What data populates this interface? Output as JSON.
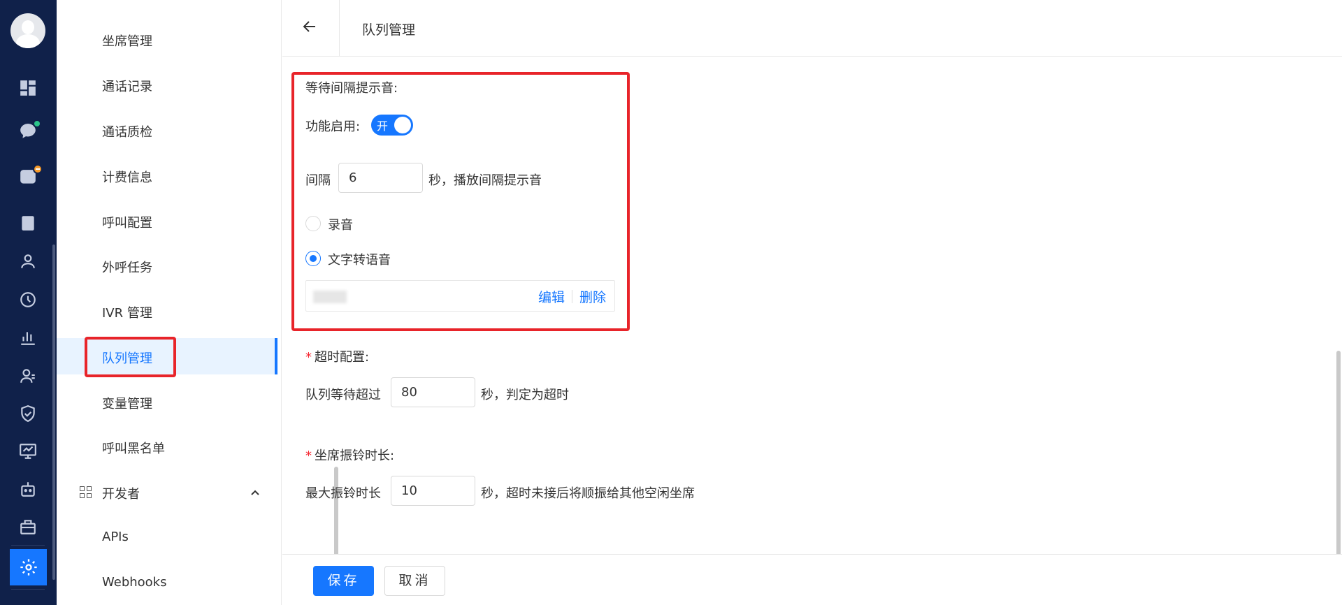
{
  "rail": {
    "icons": [
      "dashboard-icon",
      "chat-icon",
      "phone-icon",
      "clipboard-icon",
      "user-icon",
      "history-icon",
      "bar-chart-icon",
      "contacts-icon",
      "shield-icon",
      "monitor-icon",
      "robot-icon",
      "toolbox-icon",
      "gear-icon"
    ],
    "badge_colors": {
      "chat": "#2bc48a",
      "phone": "#f79a28"
    }
  },
  "subnav": {
    "items": [
      {
        "label": "坐席管理"
      },
      {
        "label": "通话记录"
      },
      {
        "label": "通话质检"
      },
      {
        "label": "计费信息"
      },
      {
        "label": "呼叫配置"
      },
      {
        "label": "外呼任务"
      },
      {
        "label": "IVR 管理"
      },
      {
        "label": "队列管理",
        "active": true
      },
      {
        "label": "变量管理"
      },
      {
        "label": "呼叫黑名单"
      }
    ],
    "group": {
      "label": "开发者",
      "expanded": true
    },
    "group_items": [
      {
        "label": "APIs"
      },
      {
        "label": "Webhooks"
      }
    ]
  },
  "header": {
    "title": "队列管理"
  },
  "form": {
    "interval_tone": {
      "section_label": "等待间隔提示音:",
      "enable_label": "功能启用:",
      "toggle_text": "开",
      "toggle_on": true,
      "interval_prefix": "间隔",
      "interval_value": "6",
      "interval_suffix": "秒，播放间隔提示音",
      "options": [
        {
          "label": "录音",
          "checked": false
        },
        {
          "label": "文字转语音",
          "checked": true
        }
      ],
      "tts_actions": {
        "edit": "编辑",
        "delete": "删除"
      }
    },
    "timeout": {
      "section_label": "超时配置:",
      "required": "*",
      "prefix": "队列等待超过",
      "value": "80",
      "suffix": "秒，判定为超时"
    },
    "ring": {
      "section_label": "坐席振铃时长:",
      "required": "*",
      "prefix": "最大振铃时长",
      "value": "10",
      "suffix": "秒，超时未接后将顺振给其他空闲坐席"
    }
  },
  "footer": {
    "save_label": "保存",
    "cancel_label": "取消"
  },
  "colors": {
    "accent": "#1677ff",
    "rail_bg": "#10214a",
    "highlight": "#e8242a"
  }
}
